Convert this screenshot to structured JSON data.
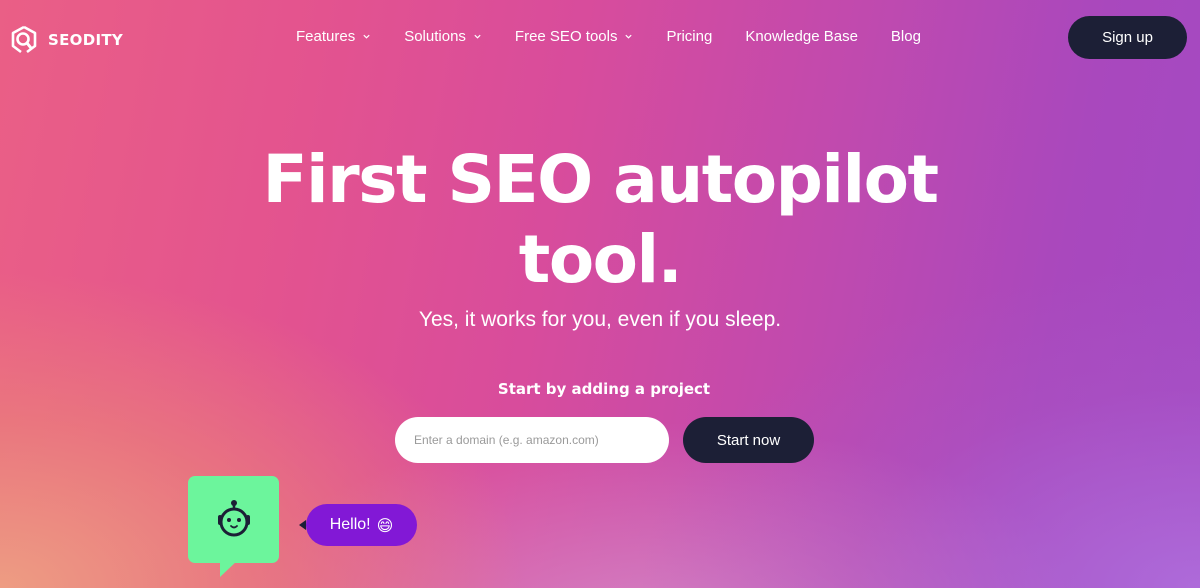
{
  "brand": {
    "name": "SEODITY",
    "logo_icon": "magnifier-hexagon-icon"
  },
  "nav": {
    "items": [
      {
        "label": "Features",
        "has_dropdown": true
      },
      {
        "label": "Solutions",
        "has_dropdown": true
      },
      {
        "label": "Free SEO tools",
        "has_dropdown": true
      },
      {
        "label": "Pricing",
        "has_dropdown": false
      },
      {
        "label": "Knowledge Base",
        "has_dropdown": false
      },
      {
        "label": "Blog",
        "has_dropdown": false
      }
    ],
    "signup_label": "Sign up"
  },
  "hero": {
    "title_line1": "First SEO autopilot",
    "title_line2": "tool.",
    "subtitle": "Yes, it works for you, even if you sleep."
  },
  "cta": {
    "label": "Start by adding a project",
    "input_placeholder": "Enter a domain (e.g. amazon.com)",
    "input_value": "",
    "button_label": "Start now"
  },
  "chat_widget": {
    "bot_icon": "robot-icon",
    "greeting": "Hello!",
    "emoji": "😄"
  },
  "colors": {
    "dark_button": "#1c1f36",
    "bot_bg": "#6cf59c",
    "bubble_bg": "#8218d6",
    "gradient_left": "#ea5f86",
    "gradient_right": "#a34ac4"
  }
}
